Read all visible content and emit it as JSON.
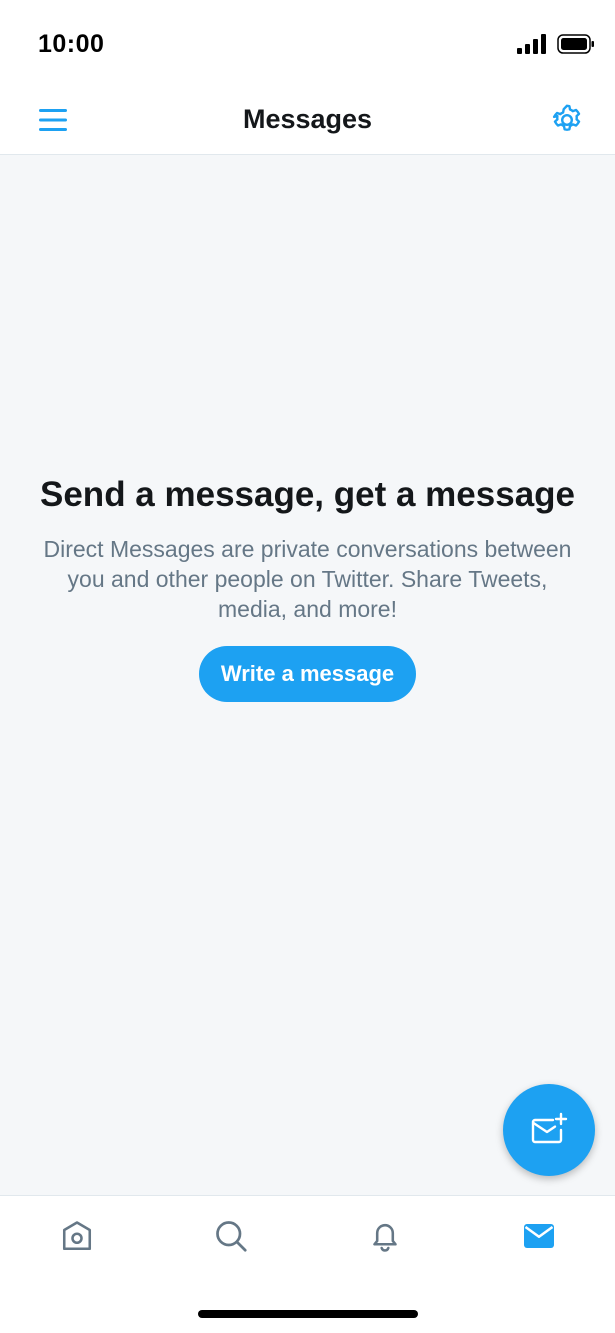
{
  "status_bar": {
    "time": "10:00",
    "icons": [
      "signal-icon",
      "battery-icon"
    ]
  },
  "header": {
    "title": "Messages",
    "menu_icon": "hamburger-menu-icon",
    "settings_icon": "gear-icon"
  },
  "empty_state": {
    "title": "Send a message, get a message",
    "description": "Direct Messages are private conversations between you and other people on Twitter. Share Tweets, media, and more!",
    "button_label": "Write a message"
  },
  "fab": {
    "icon": "new-message-icon"
  },
  "tab_bar": {
    "tabs": [
      {
        "name": "home",
        "icon": "home-icon",
        "active": false
      },
      {
        "name": "search",
        "icon": "search-icon",
        "active": false
      },
      {
        "name": "notifications",
        "icon": "bell-icon",
        "active": false
      },
      {
        "name": "messages",
        "icon": "envelope-icon",
        "active": true
      }
    ]
  },
  "colors": {
    "accent": "#1da1f2",
    "text_primary": "#14171a",
    "text_secondary": "#657786",
    "background": "#f5f7f9",
    "inactive_icon": "#657786"
  }
}
